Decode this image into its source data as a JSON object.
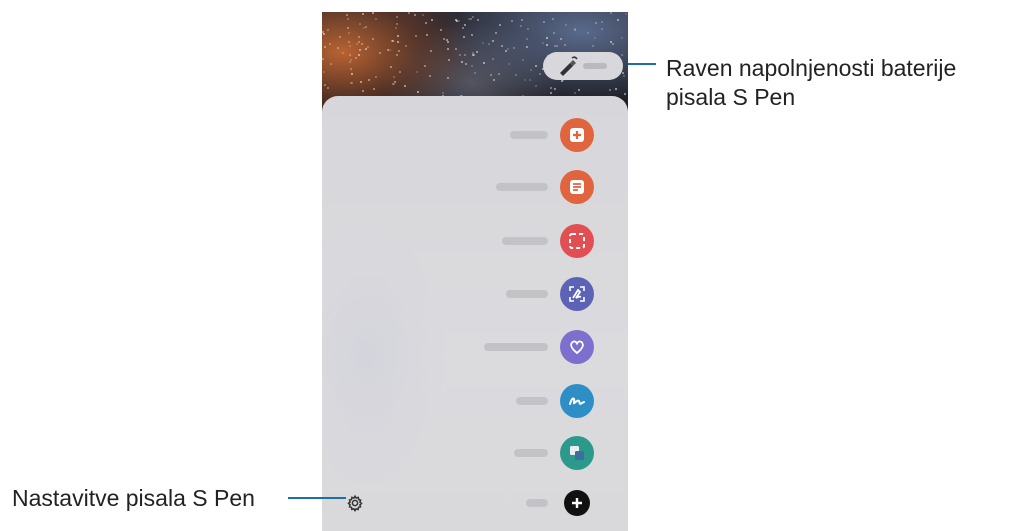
{
  "callouts": {
    "battery": "Raven napolnjenosti baterije\npisala S Pen",
    "settings": "Nastavitve pisala S Pen"
  },
  "air_command": {
    "items": [
      {
        "icon": "create-note-icon",
        "color": "#e0643e"
      },
      {
        "icon": "view-all-notes-icon",
        "color": "#e0643e"
      },
      {
        "icon": "smart-select-icon",
        "color": "#e24f52"
      },
      {
        "icon": "screen-write-icon",
        "color": "#5c63b7"
      },
      {
        "icon": "live-messages-icon",
        "color": "#7d6fce"
      },
      {
        "icon": "ar-doodle-icon",
        "color": "#2e8fc6"
      },
      {
        "icon": "translate-icon",
        "color": "#2b9a8c"
      },
      {
        "icon": "add-icon",
        "color": "#111111"
      }
    ]
  },
  "colors": {
    "callout_line": "#1c6fae",
    "panel": "#d8d8db"
  }
}
